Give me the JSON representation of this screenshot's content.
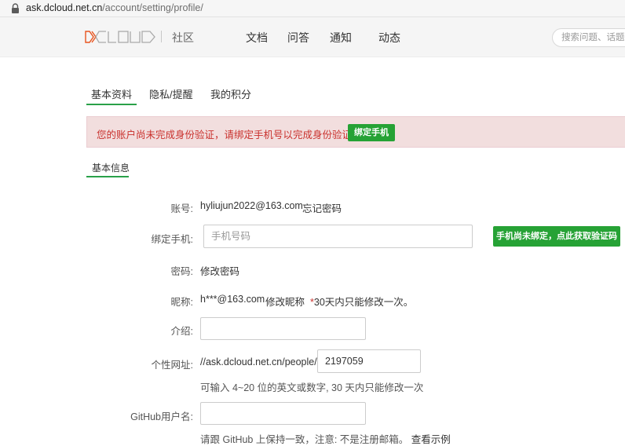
{
  "browser": {
    "url_host": "ask.dcloud.net.cn",
    "url_path": "/account/setting/profile/"
  },
  "header": {
    "logo_text": "DCLOUD",
    "community": "社区",
    "nav": [
      "文档",
      "问答",
      "通知",
      "动态"
    ],
    "search_placeholder": "搜索问题、话题"
  },
  "tabs": [
    "基本资料",
    "隐私/提醒",
    "我的积分"
  ],
  "alert": {
    "message": "您的账户尚未完成身份验证，请绑定手机号以完成身份验证！",
    "button": "绑定手机"
  },
  "section_title": "基本信息",
  "form": {
    "account": {
      "label": "账号:",
      "value": "hyliujun2022@163.com",
      "link": "忘记密码"
    },
    "phone": {
      "label": "绑定手机:",
      "placeholder": "手机号码",
      "button": "手机尚未绑定，点此获取验证码"
    },
    "password": {
      "label": "密码:",
      "link": "修改密码"
    },
    "nickname": {
      "label": "昵称:",
      "value": "h***@163.com",
      "link": "修改昵称",
      "star": "*",
      "note": "30天内只能修改一次。"
    },
    "intro": {
      "label": "介绍:",
      "value": ""
    },
    "url": {
      "label": "个性网址:",
      "prefix": "//ask.dcloud.net.cn/people/",
      "value": "2197059",
      "hint": "可输入 4~20 位的英文或数字, 30 天内只能修改一次"
    },
    "github": {
      "label": "GitHub用户名:",
      "value": "",
      "hint": "请跟 GitHub 上保持一致，注意: 不是注册邮箱。",
      "hint_link": "查看示例"
    }
  },
  "colors": {
    "accent_green": "#26a235",
    "alert_bg": "#f2dede",
    "alert_text": "#c9302c"
  }
}
